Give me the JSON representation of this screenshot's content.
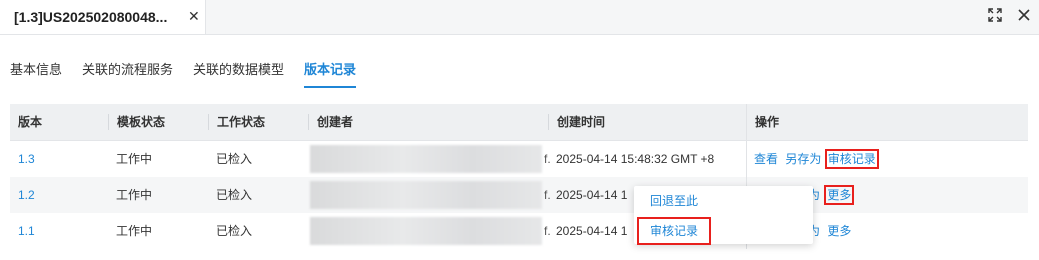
{
  "window": {
    "doc_tab_title": "[1.3]US202502080048...",
    "close_glyph": "✕"
  },
  "subtabs": [
    "基本信息",
    "关联的流程服务",
    "关联的数据模型",
    "版本记录"
  ],
  "active_subtab": "版本记录",
  "table": {
    "headers": [
      "版本",
      "模板状态",
      "工作状态",
      "创建者",
      "创建时间",
      "操作"
    ],
    "rows": [
      {
        "version": "1.3",
        "template_status": "工作中",
        "work_status": "已检入",
        "creator_tail": "f.",
        "created_time": "2025-04-14 15:48:32 GMT +8",
        "actions": [
          "查看",
          "另存为",
          "审核记录"
        ]
      },
      {
        "version": "1.2",
        "template_status": "工作中",
        "work_status": "已检入",
        "creator_tail": "f.",
        "created_time": "2025-04-14 1",
        "actions": [
          "为",
          "更多"
        ]
      },
      {
        "version": "1.1",
        "template_status": "工作中",
        "work_status": "已检入",
        "creator_tail": "f.",
        "created_time": "2025-04-14 1",
        "actions": [
          "为",
          "更多"
        ]
      }
    ]
  },
  "dropdown": {
    "items": [
      "回退至此",
      "审核记录"
    ]
  },
  "colors": {
    "accent": "#1f86d6",
    "highlight_box": "#e8201d",
    "header_bg": "#eef0f2",
    "alt_row_bg": "#f5f6f7"
  },
  "icons": [
    "fullscreen-icon",
    "close-icon"
  ]
}
